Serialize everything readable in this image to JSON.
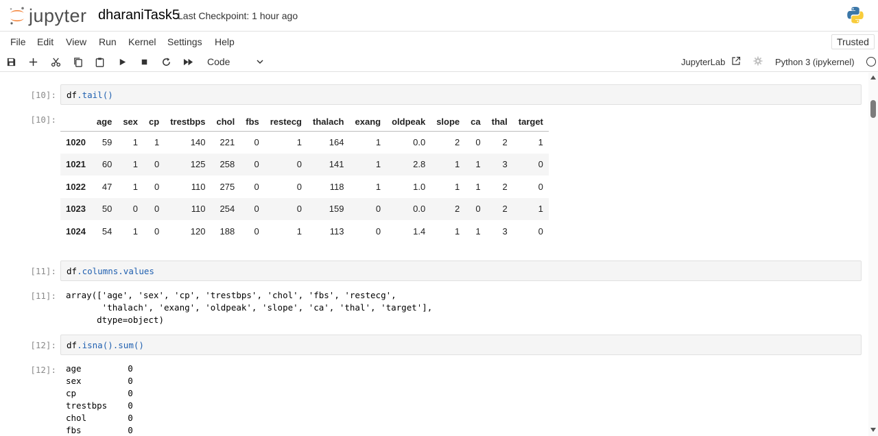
{
  "header": {
    "logo_text": "jupyter",
    "notebook_title": "dharaniTask5",
    "checkpoint": "Last Checkpoint: 1 hour ago"
  },
  "menu": [
    "File",
    "Edit",
    "View",
    "Run",
    "Kernel",
    "Settings",
    "Help"
  ],
  "trusted": "Trusted",
  "toolbar": {
    "icons": [
      "save-icon",
      "add-icon",
      "cut-icon",
      "copy-icon",
      "paste-icon",
      "run-icon",
      "stop-icon",
      "restart-icon",
      "fast-forward-icon"
    ],
    "cell_type": "Code",
    "jupyterlab_label": "JupyterLab",
    "kernel_name": "Python 3 (ipykernel)"
  },
  "cells": {
    "c10": {
      "in_prompt": "[10]:",
      "code_var": "df",
      "code_rest": ".tail()",
      "out_prompt": "[10]:",
      "table": {
        "columns": [
          "age",
          "sex",
          "cp",
          "trestbps",
          "chol",
          "fbs",
          "restecg",
          "thalach",
          "exang",
          "oldpeak",
          "slope",
          "ca",
          "thal",
          "target"
        ],
        "rows": [
          {
            "index": "1020",
            "values": [
              "59",
              "1",
              "1",
              "140",
              "221",
              "0",
              "1",
              "164",
              "1",
              "0.0",
              "2",
              "0",
              "2",
              "1"
            ]
          },
          {
            "index": "1021",
            "values": [
              "60",
              "1",
              "0",
              "125",
              "258",
              "0",
              "0",
              "141",
              "1",
              "2.8",
              "1",
              "1",
              "3",
              "0"
            ]
          },
          {
            "index": "1022",
            "values": [
              "47",
              "1",
              "0",
              "110",
              "275",
              "0",
              "0",
              "118",
              "1",
              "1.0",
              "1",
              "1",
              "2",
              "0"
            ]
          },
          {
            "index": "1023",
            "values": [
              "50",
              "0",
              "0",
              "110",
              "254",
              "0",
              "0",
              "159",
              "0",
              "0.0",
              "2",
              "0",
              "2",
              "1"
            ]
          },
          {
            "index": "1024",
            "values": [
              "54",
              "1",
              "0",
              "120",
              "188",
              "0",
              "1",
              "113",
              "0",
              "1.4",
              "1",
              "1",
              "3",
              "0"
            ]
          }
        ]
      }
    },
    "c11": {
      "in_prompt": "[11]:",
      "code_var": "df",
      "code_rest": ".columns.values",
      "out_prompt": "[11]:",
      "output": "array(['age', 'sex', 'cp', 'trestbps', 'chol', 'fbs', 'restecg',\n       'thalach', 'exang', 'oldpeak', 'slope', 'ca', 'thal', 'target'],\n      dtype=object)"
    },
    "c12": {
      "in_prompt": "[12]:",
      "code_var": "df",
      "code_rest": ".isna().sum()",
      "out_prompt": "[12]:",
      "output": "age         0\nsex         0\ncp          0\ntrestbps    0\nchol        0\nfbs         0"
    }
  }
}
